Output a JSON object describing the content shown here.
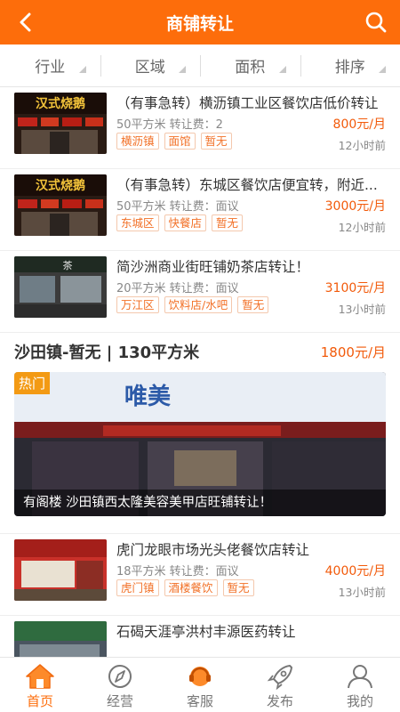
{
  "header": {
    "title": "商铺转让"
  },
  "filters": [
    {
      "label": "行业"
    },
    {
      "label": "区域"
    },
    {
      "label": "面积"
    },
    {
      "label": "排序"
    }
  ],
  "listings": [
    {
      "title": "（有事急转）横沥镇工业区餐饮店低价转让",
      "meta": "50平方米 转让费：2",
      "price": "800元/月",
      "tags": [
        "横沥镇",
        "面馆",
        "暂无"
      ],
      "time": "12小时前",
      "thumb_sign": "汉式烧鹅"
    },
    {
      "title": "（有事急转）东城区餐饮店便宜转，附近...",
      "meta": "50平方米 转让费：面议",
      "price": "3000元/月",
      "tags": [
        "东城区",
        "快餐店",
        "暂无"
      ],
      "time": "12小时前",
      "thumb_sign": "汉式烧鹅"
    },
    {
      "title": "简沙洲商业街旺铺奶茶店转让！",
      "meta": "20平方米 转让费：面议",
      "price": "3100元/月",
      "tags": [
        "万江区",
        "饮料店/水吧",
        "暂无"
      ],
      "time": "13小时前",
      "thumb_sign": "茶"
    }
  ],
  "featured": {
    "title": "沙田镇-暂无 | 130平方米",
    "price": "1800元/月",
    "badge": "热门",
    "caption": "有阁楼 沙田镇西太隆美容美甲店旺铺转让！",
    "sign": "唯美"
  },
  "listings2": [
    {
      "title": "虎门龙眼市场光头佬餐饮店转让",
      "meta": "18平方米 转让费：面议",
      "price": "4000元/月",
      "tags": [
        "虎门镇",
        "酒楼餐饮",
        "暂无"
      ],
      "time": "13小时前"
    },
    {
      "title": "石碣天涯亭洪村丰源医药转让"
    }
  ],
  "tabbar": [
    {
      "label": "首页",
      "icon": "home-icon",
      "active": true
    },
    {
      "label": "经营",
      "icon": "compass-icon",
      "active": false
    },
    {
      "label": "客服",
      "icon": "headset-icon",
      "active": false
    },
    {
      "label": "发布",
      "icon": "rocket-icon",
      "active": false
    },
    {
      "label": "我的",
      "icon": "user-icon",
      "active": false
    }
  ],
  "colors": {
    "accent": "#fd6d0b",
    "price": "#f25a0a",
    "tag": "#f27026",
    "badge": "#f39a14"
  }
}
